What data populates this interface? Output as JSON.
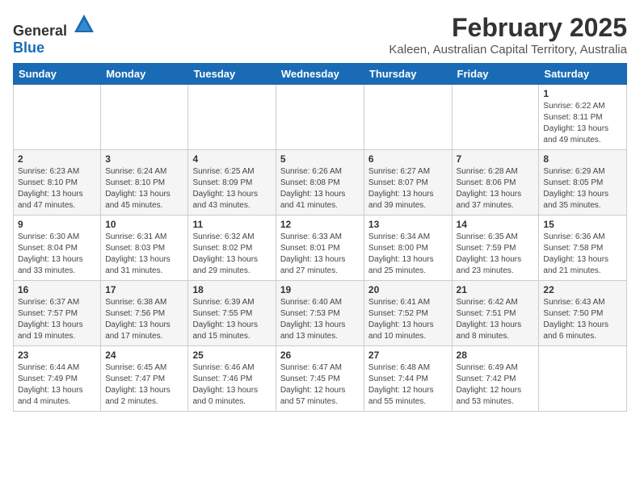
{
  "logo": {
    "general": "General",
    "blue": "Blue"
  },
  "title": "February 2025",
  "subtitle": "Kaleen, Australian Capital Territory, Australia",
  "days_of_week": [
    "Sunday",
    "Monday",
    "Tuesday",
    "Wednesday",
    "Thursday",
    "Friday",
    "Saturday"
  ],
  "weeks": [
    [
      {
        "num": "",
        "info": ""
      },
      {
        "num": "",
        "info": ""
      },
      {
        "num": "",
        "info": ""
      },
      {
        "num": "",
        "info": ""
      },
      {
        "num": "",
        "info": ""
      },
      {
        "num": "",
        "info": ""
      },
      {
        "num": "1",
        "info": "Sunrise: 6:22 AM\nSunset: 8:11 PM\nDaylight: 13 hours\nand 49 minutes."
      }
    ],
    [
      {
        "num": "2",
        "info": "Sunrise: 6:23 AM\nSunset: 8:10 PM\nDaylight: 13 hours\nand 47 minutes."
      },
      {
        "num": "3",
        "info": "Sunrise: 6:24 AM\nSunset: 8:10 PM\nDaylight: 13 hours\nand 45 minutes."
      },
      {
        "num": "4",
        "info": "Sunrise: 6:25 AM\nSunset: 8:09 PM\nDaylight: 13 hours\nand 43 minutes."
      },
      {
        "num": "5",
        "info": "Sunrise: 6:26 AM\nSunset: 8:08 PM\nDaylight: 13 hours\nand 41 minutes."
      },
      {
        "num": "6",
        "info": "Sunrise: 6:27 AM\nSunset: 8:07 PM\nDaylight: 13 hours\nand 39 minutes."
      },
      {
        "num": "7",
        "info": "Sunrise: 6:28 AM\nSunset: 8:06 PM\nDaylight: 13 hours\nand 37 minutes."
      },
      {
        "num": "8",
        "info": "Sunrise: 6:29 AM\nSunset: 8:05 PM\nDaylight: 13 hours\nand 35 minutes."
      }
    ],
    [
      {
        "num": "9",
        "info": "Sunrise: 6:30 AM\nSunset: 8:04 PM\nDaylight: 13 hours\nand 33 minutes."
      },
      {
        "num": "10",
        "info": "Sunrise: 6:31 AM\nSunset: 8:03 PM\nDaylight: 13 hours\nand 31 minutes."
      },
      {
        "num": "11",
        "info": "Sunrise: 6:32 AM\nSunset: 8:02 PM\nDaylight: 13 hours\nand 29 minutes."
      },
      {
        "num": "12",
        "info": "Sunrise: 6:33 AM\nSunset: 8:01 PM\nDaylight: 13 hours\nand 27 minutes."
      },
      {
        "num": "13",
        "info": "Sunrise: 6:34 AM\nSunset: 8:00 PM\nDaylight: 13 hours\nand 25 minutes."
      },
      {
        "num": "14",
        "info": "Sunrise: 6:35 AM\nSunset: 7:59 PM\nDaylight: 13 hours\nand 23 minutes."
      },
      {
        "num": "15",
        "info": "Sunrise: 6:36 AM\nSunset: 7:58 PM\nDaylight: 13 hours\nand 21 minutes."
      }
    ],
    [
      {
        "num": "16",
        "info": "Sunrise: 6:37 AM\nSunset: 7:57 PM\nDaylight: 13 hours\nand 19 minutes."
      },
      {
        "num": "17",
        "info": "Sunrise: 6:38 AM\nSunset: 7:56 PM\nDaylight: 13 hours\nand 17 minutes."
      },
      {
        "num": "18",
        "info": "Sunrise: 6:39 AM\nSunset: 7:55 PM\nDaylight: 13 hours\nand 15 minutes."
      },
      {
        "num": "19",
        "info": "Sunrise: 6:40 AM\nSunset: 7:53 PM\nDaylight: 13 hours\nand 13 minutes."
      },
      {
        "num": "20",
        "info": "Sunrise: 6:41 AM\nSunset: 7:52 PM\nDaylight: 13 hours\nand 10 minutes."
      },
      {
        "num": "21",
        "info": "Sunrise: 6:42 AM\nSunset: 7:51 PM\nDaylight: 13 hours\nand 8 minutes."
      },
      {
        "num": "22",
        "info": "Sunrise: 6:43 AM\nSunset: 7:50 PM\nDaylight: 13 hours\nand 6 minutes."
      }
    ],
    [
      {
        "num": "23",
        "info": "Sunrise: 6:44 AM\nSunset: 7:49 PM\nDaylight: 13 hours\nand 4 minutes."
      },
      {
        "num": "24",
        "info": "Sunrise: 6:45 AM\nSunset: 7:47 PM\nDaylight: 13 hours\nand 2 minutes."
      },
      {
        "num": "25",
        "info": "Sunrise: 6:46 AM\nSunset: 7:46 PM\nDaylight: 13 hours\nand 0 minutes."
      },
      {
        "num": "26",
        "info": "Sunrise: 6:47 AM\nSunset: 7:45 PM\nDaylight: 12 hours\nand 57 minutes."
      },
      {
        "num": "27",
        "info": "Sunrise: 6:48 AM\nSunset: 7:44 PM\nDaylight: 12 hours\nand 55 minutes."
      },
      {
        "num": "28",
        "info": "Sunrise: 6:49 AM\nSunset: 7:42 PM\nDaylight: 12 hours\nand 53 minutes."
      },
      {
        "num": "",
        "info": ""
      }
    ]
  ]
}
